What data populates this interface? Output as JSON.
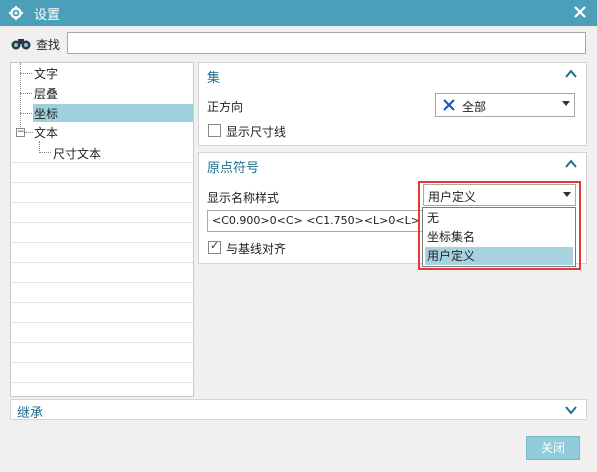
{
  "window": {
    "title": "设置"
  },
  "search": {
    "label": "查找",
    "value": ""
  },
  "tree": {
    "items": [
      {
        "label": "文字"
      },
      {
        "label": "层叠"
      },
      {
        "label": "坐标"
      },
      {
        "label": "文本"
      },
      {
        "label": "尺寸文本"
      }
    ]
  },
  "set_panel": {
    "title": "集",
    "direction_label": "正方向",
    "direction_value": "全部",
    "show_dim_line_label": "显示尺寸线",
    "show_dim_line_checked": false
  },
  "origin_panel": {
    "title": "原点符号",
    "name_style_label": "显示名称样式",
    "name_style_value": "用户定义",
    "expression_value": "<C0.900>0<C>   <C1.750><L>0<L>",
    "align_label": "与基线对齐",
    "align_checked": true,
    "options": [
      "无",
      "坐标集名",
      "用户定义"
    ]
  },
  "inherit": {
    "label": "继承"
  },
  "footer": {
    "close_label": "关闭"
  },
  "colors": {
    "titlebar": "#4b9fb8",
    "accent": "#1e6f8c",
    "highlight": "#e53935"
  }
}
